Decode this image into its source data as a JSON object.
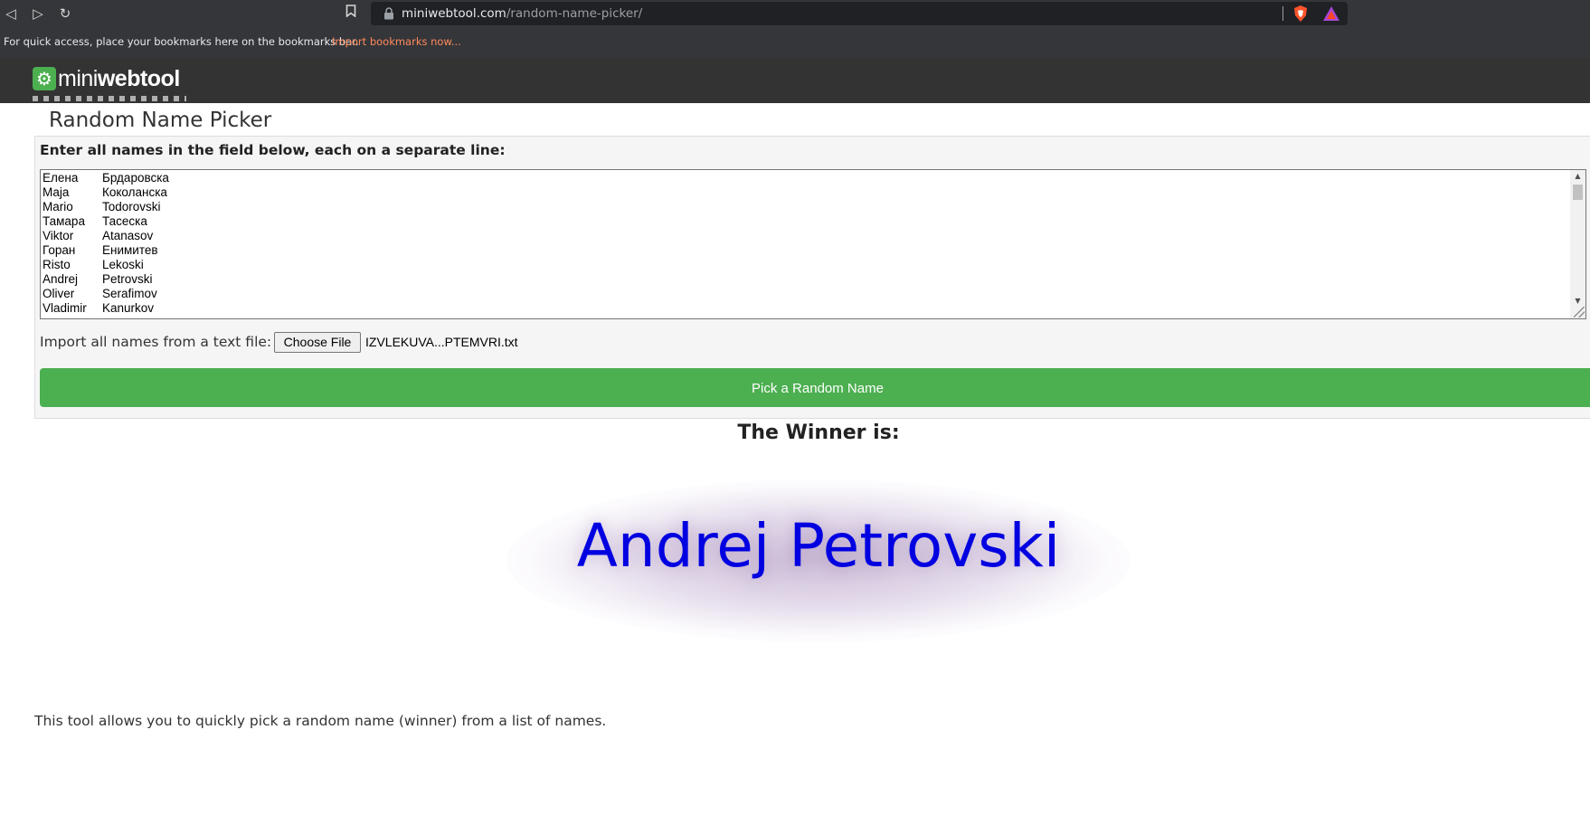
{
  "browser": {
    "nav": {
      "back_icon": "◁",
      "forward_icon": "▷",
      "reload_icon": "↻",
      "bookmark_icon": "bookmark-icon"
    },
    "address": {
      "domain": "miniwebtool.com",
      "path": "/random-name-picker/"
    },
    "bookmarks_bar": {
      "text": "For quick access, place your bookmarks here on the bookmarks bar.",
      "link": "Import bookmarks now..."
    }
  },
  "site": {
    "logo_mini": "mini",
    "logo_web": "webtool"
  },
  "page": {
    "title": "Random Name Picker",
    "form_label": "Enter all names in the field below, each on a separate line:",
    "names": [
      {
        "first": "Елена",
        "last": "Брдаровска"
      },
      {
        "first": "Маја",
        "last": "Коколанска"
      },
      {
        "first": "Mario",
        "last": "Todorovski"
      },
      {
        "first": "Тамара",
        "last": "Тасеска"
      },
      {
        "first": "Viktor",
        "last": "Atanasov"
      },
      {
        "first": "Горан",
        "last": "Енимитев"
      },
      {
        "first": "Risto",
        "last": "Lekoski"
      },
      {
        "first": "Andrej",
        "last": "Petrovski"
      },
      {
        "first": "Oliver",
        "last": "Serafimov"
      },
      {
        "first": "Vladimir",
        "last": "Kanurkov"
      }
    ],
    "import_label": "Import all names from a text file:",
    "file_button": "Choose File",
    "file_name": "IZVLEKUVA...PTEMVRI.txt",
    "pick_button": "Pick a Random Name",
    "winner_heading": "The Winner is:",
    "winner_name": "Andrej Petrovski",
    "description": "This tool allows you to quickly pick a random name (winner) from a list of names."
  },
  "colors": {
    "accent_green": "#4caf50",
    "winner_blue": "#0000e0",
    "header_dark": "#333333",
    "bookmark_link": "#ff8a5c"
  }
}
